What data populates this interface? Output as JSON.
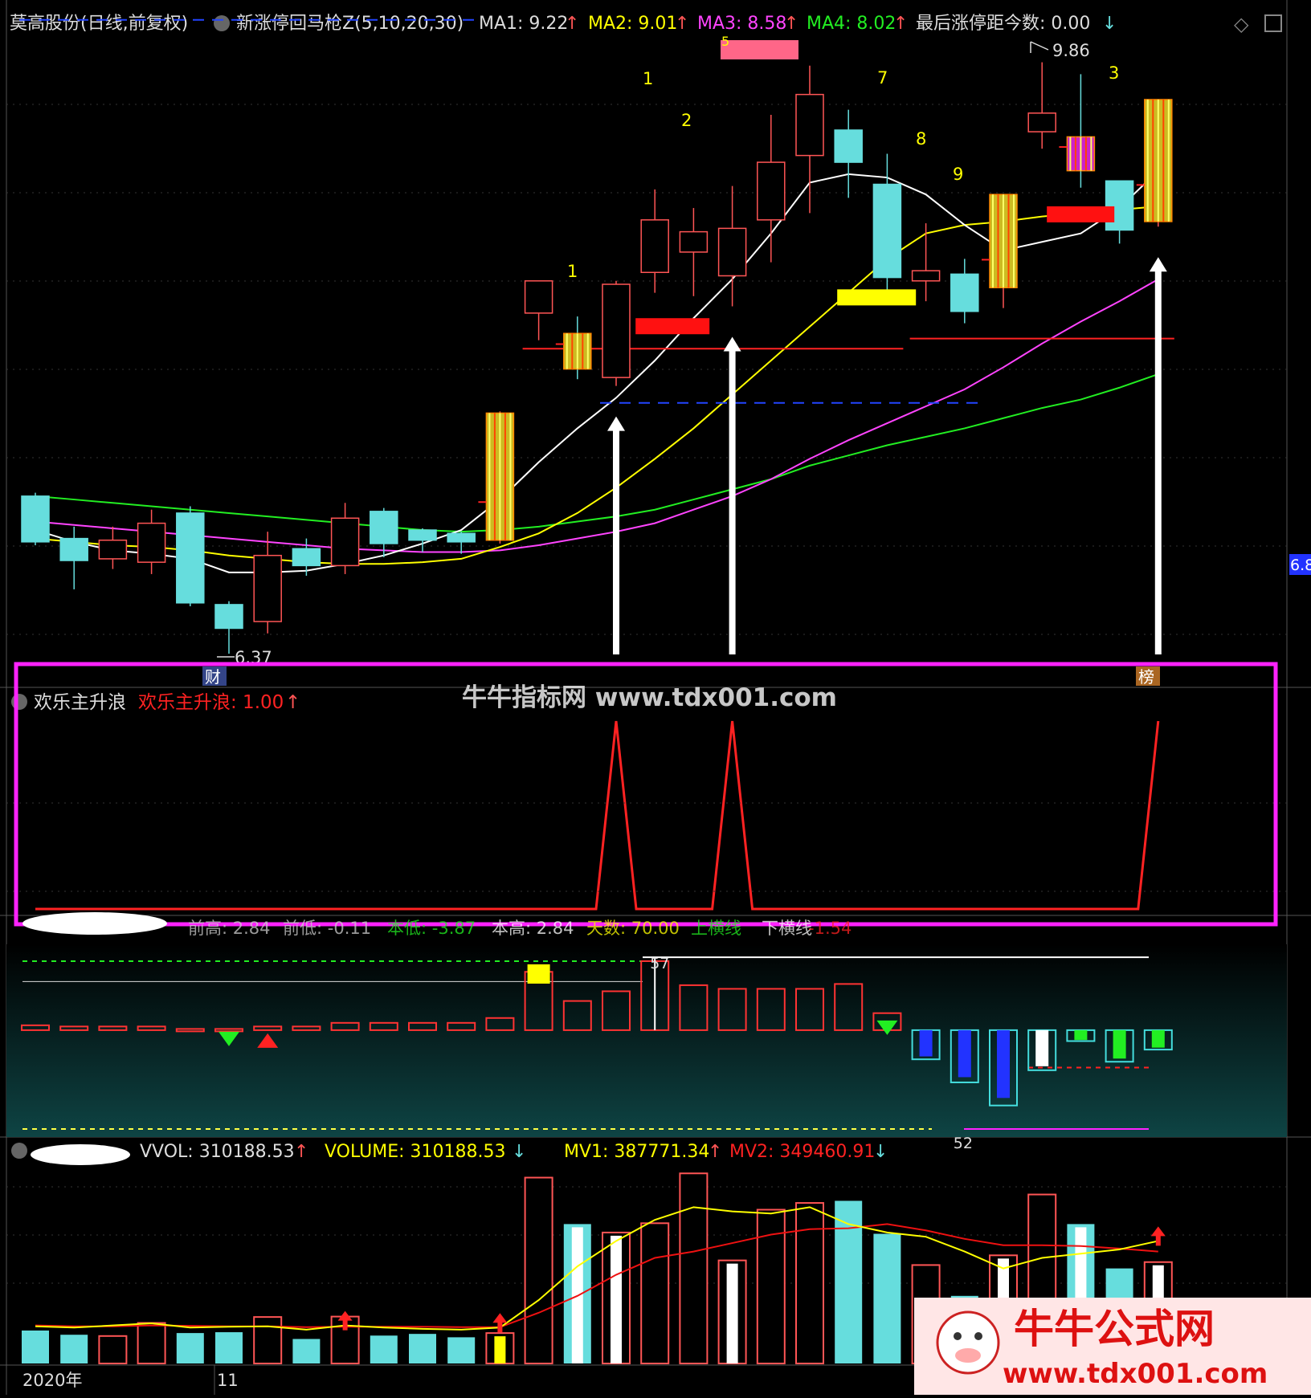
{
  "colors": {
    "bg": "#000000",
    "up": "#ff5555",
    "down": "#66dddd",
    "ma1": "#ffffff",
    "ma2": "#ffff00",
    "ma3": "#ff44ff",
    "ma4": "#22ee22",
    "magenta_frame": "#ff22ff",
    "panel_teal": "#0d3a3a",
    "label_red": "#ff2222",
    "label_yellow": "#ffff00",
    "label_green": "#22ee22",
    "label_white": "#dddddd"
  },
  "price_panel": {
    "stock_title": "莫高股份(日线,前复权)",
    "indicator_name": "新涨停回马枪Z(5,10,20,30)",
    "ma1": {
      "label": "MA1: 9.22",
      "arrow": "↑"
    },
    "ma2": {
      "label": "MA2: 9.01",
      "arrow": "↑"
    },
    "ma3": {
      "label": "MA3: 8.58",
      "arrow": "↑"
    },
    "ma4": {
      "label": "MA4: 8.02",
      "arrow": "↑"
    },
    "last_limit": {
      "label": "最后涨停距今数: 0.00",
      "arrow": "↓"
    },
    "high_mark": "9.86",
    "low_mark": "6.37",
    "axis_tag": "6.8",
    "bottom_tags": [
      "财",
      "榜"
    ],
    "wave_numbers": [
      "1",
      "1",
      "2",
      "7",
      "8",
      "9",
      "3"
    ],
    "top_partial_number": "5"
  },
  "chart_data": {
    "type": "candlestick",
    "candles": [
      {
        "o": 7.3,
        "h": 7.32,
        "l": 7.01,
        "c": 7.03
      },
      {
        "o": 7.05,
        "h": 7.12,
        "l": 6.75,
        "c": 6.92
      },
      {
        "o": 6.93,
        "h": 7.12,
        "l": 6.87,
        "c": 7.04
      },
      {
        "o": 6.91,
        "h": 7.22,
        "l": 6.84,
        "c": 7.14
      },
      {
        "o": 7.2,
        "h": 7.24,
        "l": 6.65,
        "c": 6.67
      },
      {
        "o": 6.66,
        "h": 6.68,
        "l": 6.37,
        "c": 6.52
      },
      {
        "o": 6.56,
        "h": 7.09,
        "l": 6.49,
        "c": 6.95
      },
      {
        "o": 6.99,
        "h": 7.05,
        "l": 6.83,
        "c": 6.89
      },
      {
        "o": 6.89,
        "h": 7.26,
        "l": 6.84,
        "c": 7.17
      },
      {
        "o": 7.21,
        "h": 7.23,
        "l": 6.94,
        "c": 7.02
      },
      {
        "o": 7.1,
        "h": 7.11,
        "l": 6.97,
        "c": 7.04
      },
      {
        "o": 7.08,
        "h": 7.09,
        "l": 6.96,
        "c": 7.03
      },
      {
        "o": 7.04,
        "h": 7.8,
        "l": 7.02,
        "c": 7.79
      },
      {
        "o": 8.38,
        "h": 8.57,
        "l": 8.22,
        "c": 8.57
      },
      {
        "o": 8.26,
        "h": 8.36,
        "l": 7.99,
        "c": 8.05
      },
      {
        "o": 8.0,
        "h": 8.57,
        "l": 7.95,
        "c": 8.55
      },
      {
        "o": 8.62,
        "h": 9.11,
        "l": 8.5,
        "c": 8.93
      },
      {
        "o": 8.74,
        "h": 9.0,
        "l": 8.48,
        "c": 8.86
      },
      {
        "o": 8.6,
        "h": 9.13,
        "l": 8.42,
        "c": 8.88
      },
      {
        "o": 8.93,
        "h": 9.55,
        "l": 8.68,
        "c": 9.27
      },
      {
        "o": 9.31,
        "h": 9.84,
        "l": 8.97,
        "c": 9.67
      },
      {
        "o": 9.46,
        "h": 9.58,
        "l": 9.06,
        "c": 9.27
      },
      {
        "o": 9.14,
        "h": 9.32,
        "l": 8.49,
        "c": 8.59
      },
      {
        "o": 8.57,
        "h": 8.91,
        "l": 8.45,
        "c": 8.63
      },
      {
        "o": 8.61,
        "h": 8.7,
        "l": 8.32,
        "c": 8.39
      },
      {
        "o": 8.53,
        "h": 9.07,
        "l": 8.41,
        "c": 9.08
      },
      {
        "o": 9.45,
        "h": 9.86,
        "l": 9.35,
        "c": 9.56
      },
      {
        "o": 9.42,
        "h": 9.79,
        "l": 9.12,
        "c": 9.22
      },
      {
        "o": 9.16,
        "h": 9.16,
        "l": 8.79,
        "c": 8.87
      },
      {
        "o": 8.92,
        "h": 9.6,
        "l": 8.89,
        "c": 9.64
      }
    ],
    "ma1": [
      7.1,
      7.03,
      6.98,
      6.96,
      6.93,
      6.85,
      6.85,
      6.86,
      6.9,
      6.95,
      7.02,
      7.1,
      7.28,
      7.5,
      7.7,
      7.88,
      8.1,
      8.35,
      8.58,
      8.85,
      9.15,
      9.2,
      9.18,
      9.08,
      8.9,
      8.75,
      8.8,
      8.85,
      9.0,
      9.22
    ],
    "ma2": [
      7.05,
      7.03,
      7.01,
      7.0,
      6.98,
      6.95,
      6.93,
      6.91,
      6.9,
      6.9,
      6.91,
      6.93,
      7.0,
      7.08,
      7.2,
      7.35,
      7.52,
      7.7,
      7.9,
      8.1,
      8.3,
      8.5,
      8.7,
      8.85,
      8.9,
      8.92,
      8.95,
      8.97,
      8.99,
      9.01
    ],
    "ma3": [
      7.15,
      7.13,
      7.11,
      7.09,
      7.07,
      7.05,
      7.03,
      7.01,
      6.99,
      6.98,
      6.97,
      6.97,
      6.98,
      7.01,
      7.05,
      7.09,
      7.14,
      7.22,
      7.3,
      7.4,
      7.52,
      7.63,
      7.73,
      7.83,
      7.93,
      8.06,
      8.2,
      8.33,
      8.45,
      8.58
    ],
    "ma4": [
      7.3,
      7.28,
      7.26,
      7.24,
      7.22,
      7.2,
      7.18,
      7.16,
      7.14,
      7.12,
      7.1,
      7.09,
      7.1,
      7.12,
      7.15,
      7.18,
      7.22,
      7.28,
      7.34,
      7.4,
      7.48,
      7.54,
      7.6,
      7.65,
      7.7,
      7.76,
      7.82,
      7.87,
      7.94,
      8.02
    ],
    "ylim": [
      6.2,
      10.0
    ],
    "highlight_days": [
      12,
      14,
      25,
      27,
      29
    ],
    "signal_days": [
      15,
      18,
      29
    ]
  },
  "wave_panel": {
    "name": "欢乐主升浪",
    "label": "欢乐主升浪: 1.00",
    "arrow": "↑",
    "values": [
      0,
      0,
      0,
      0,
      0,
      0,
      0,
      0,
      0,
      0,
      0,
      0,
      0,
      0,
      0,
      1,
      0,
      0,
      1,
      0,
      0,
      0,
      0,
      0,
      0,
      0,
      0,
      0,
      0,
      1
    ],
    "ylim": [
      0,
      1
    ]
  },
  "watermark": {
    "text": "牛牛指标网 www.tdx001.com"
  },
  "swing_panel": {
    "labels": [
      {
        "text": "前高: 2.84",
        "color": "#cccccc"
      },
      {
        "text": "前低: -0.11",
        "color": "#cccccc"
      },
      {
        "text": "本低: -3.87",
        "color": "#22ee22"
      },
      {
        "text": "本高: 2.84",
        "color": "#ffffff"
      },
      {
        "text": "天数: 70.00",
        "color": "#ffff00"
      },
      {
        "text": "上横线",
        "color": "#22ee22"
      },
      {
        "text": "下横线",
        "color": "#ffffff"
      },
      {
        "text": "-1.54",
        "color": "#ff2222"
      }
    ],
    "values": [
      0.2,
      0.15,
      0.15,
      0.15,
      0.05,
      0.05,
      0.15,
      0.15,
      0.3,
      0.3,
      0.3,
      0.3,
      0.5,
      2.4,
      1.2,
      1.6,
      2.84,
      1.85,
      1.7,
      1.7,
      1.7,
      1.9,
      0.7,
      -1.2,
      -2.15,
      -3.1,
      -1.65,
      -0.45,
      -1.3,
      -0.8
    ],
    "mark_top": "57",
    "mark_bottom": "52",
    "ylim": [
      -4.2,
      3.4
    ]
  },
  "volume_panel": {
    "vol_label": "VVOL: 310188.53",
    "vol_arrow": "↑",
    "volume_label": "VOLUME: 310188.53",
    "volume_arrow": "↓",
    "mv1_label": "MV1: 387771.34",
    "mv1_arrow": "↑",
    "mv2_label": "MV2: 349460.91",
    "mv2_arrow": "↓",
    "volumes": [
      78000,
      68000,
      65000,
      96000,
      72000,
      74000,
      110000,
      58000,
      111000,
      66000,
      70000,
      62000,
      72000,
      440000,
      330000,
      310000,
      332000,
      450000,
      244000,
      364000,
      380000,
      385000,
      307000,
      233000,
      160000,
      256000,
      400000,
      330000,
      225000,
      240000
    ],
    "mv1": [
      88000,
      85000,
      90000,
      95000,
      85000,
      87000,
      88000,
      80000,
      90000,
      85000,
      82000,
      80000,
      85000,
      150000,
      230000,
      290000,
      340000,
      370000,
      360000,
      355000,
      370000,
      330000,
      310000,
      300000,
      265000,
      225000,
      250000,
      260000,
      270000,
      290000
    ],
    "mv2": [
      90000,
      88000,
      88000,
      90000,
      89000,
      88000,
      88000,
      86000,
      87000,
      87000,
      87000,
      86000,
      86000,
      120000,
      160000,
      210000,
      250000,
      265000,
      285000,
      305000,
      318000,
      320000,
      330000,
      315000,
      295000,
      280000,
      280000,
      278000,
      272000,
      265000
    ],
    "ylim": [
      0,
      460000
    ],
    "date_labels": [
      "2020年",
      "11"
    ]
  },
  "brand_banner": {
    "title": "牛牛公式网",
    "url": "www.tdx001.com"
  }
}
